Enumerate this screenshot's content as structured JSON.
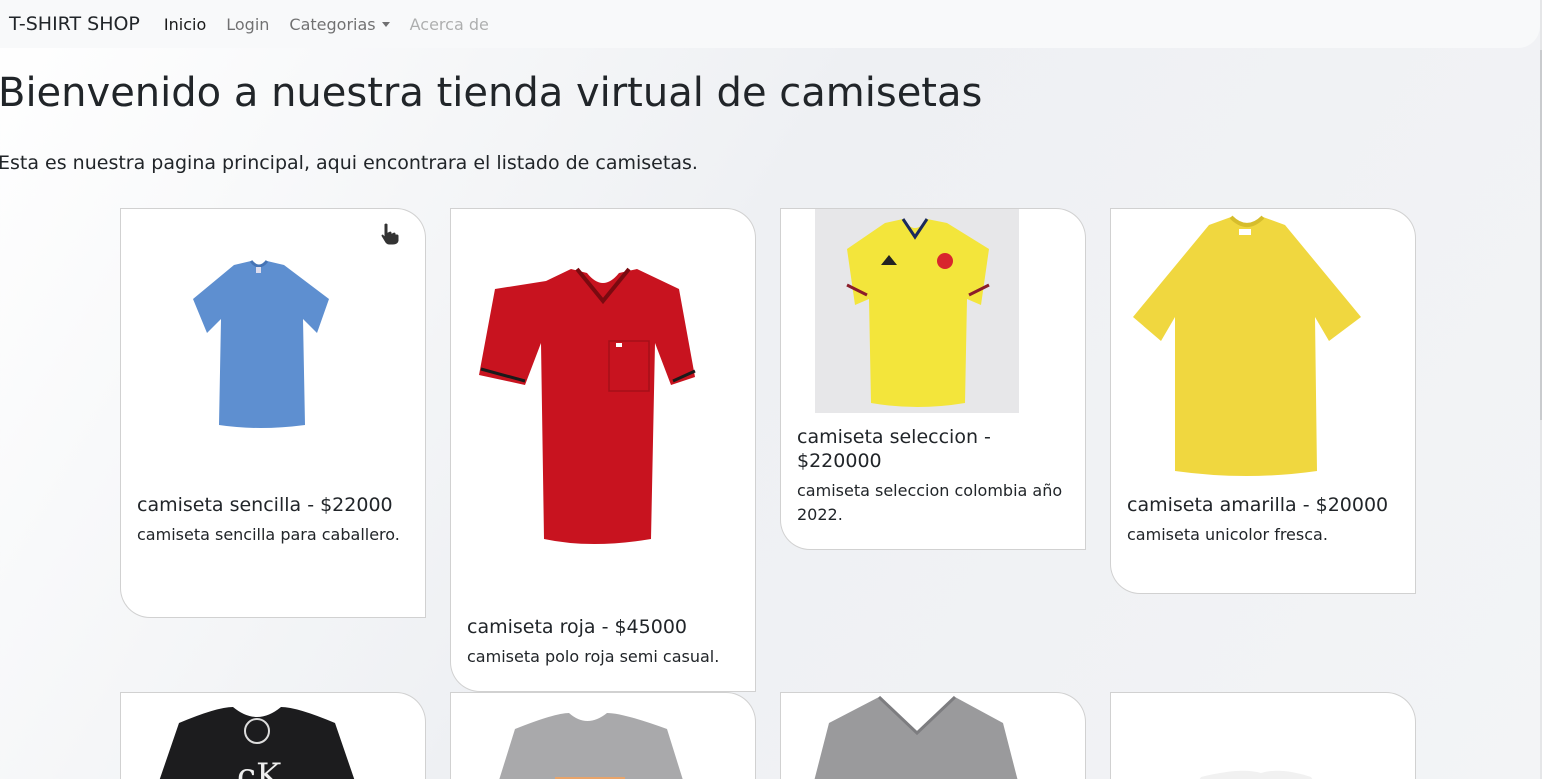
{
  "navbar": {
    "brand": "T-SHIRT SHOP",
    "links": [
      {
        "label": "Inicio"
      },
      {
        "label": "Login"
      },
      {
        "label": "Categorias"
      },
      {
        "label": "Acerca de"
      }
    ]
  },
  "hero": {
    "title": "Bienvenido a nuestra tienda virtual de camisetas",
    "subtitle": "Esta es nuestra pagina principal, aqui encontrara el listado de camisetas."
  },
  "products": [
    {
      "title": "camiseta sencilla - $22000",
      "description": "camiseta sencilla para caballero.",
      "image": "light-blue-tshirt",
      "color": "#5e8fd0"
    },
    {
      "title": "camiseta roja - $45000",
      "description": "camiseta polo roja semi casual.",
      "image": "red-polo-shirt",
      "color": "#c8131f"
    },
    {
      "title": "camiseta seleccion - $220000",
      "description": "camiseta seleccion colombia año 2022.",
      "image": "colombia-jersey",
      "color": "#f3e53b"
    },
    {
      "title": "camiseta amarilla - $20000",
      "description": "camiseta unicolor fresca.",
      "image": "yellow-tshirt",
      "color": "#f0d73f"
    },
    {
      "image": "black-ck-tshirt",
      "color": "#1c1c1e"
    },
    {
      "image": "gray-print-tshirt",
      "color": "#a9a9ab"
    },
    {
      "image": "gray-vneck-tshirt",
      "color": "#9a9a9c"
    },
    {
      "image": "white-tshirt",
      "color": "#f4f4f4"
    }
  ]
}
